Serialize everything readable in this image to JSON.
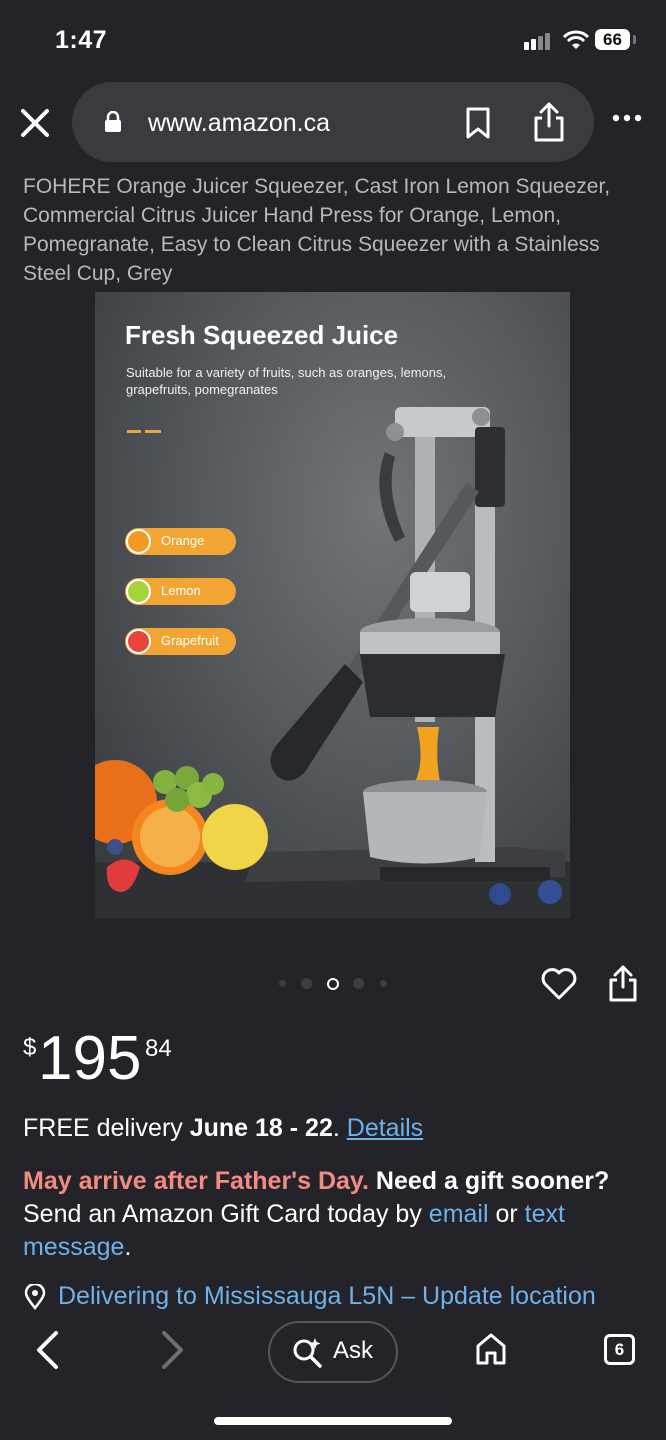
{
  "status_bar": {
    "time": "1:47",
    "battery": "66"
  },
  "browser": {
    "url": "www.amazon.ca"
  },
  "product": {
    "title": "FOHERE Orange Juicer Squeezer, Cast Iron Lemon Squeezer, Commercial Citrus Juicer Hand Press for Orange, Lemon, Pomegranate, Easy to Clean Citrus Squeezer with a Stainless Steel Cup, Grey",
    "image": {
      "heading": "Fresh Squeezed Juice",
      "subtitle": "Suitable for a variety of fruits, such as oranges, lemons, grapefruits, pomegranates",
      "fruits": [
        "Orange",
        "Lemon",
        "Grapefruit"
      ]
    },
    "carousel": {
      "total_dots": 5,
      "active_index": 2
    },
    "price": {
      "symbol": "$",
      "whole": "195",
      "fraction": "84"
    }
  },
  "delivery": {
    "prefix": "FREE delivery ",
    "dates": "June 18 - 22",
    "period": ". ",
    "details_link": "Details"
  },
  "gift": {
    "warning": "May arrive after Father's Day.",
    "question": "Need a gift sooner?",
    "text1": "Send an Amazon Gift Card today by ",
    "email_link": "email",
    "or": " or ",
    "text_link": "text message",
    "end": "."
  },
  "location": {
    "label": "Delivering to Mississauga L5N – Update location"
  },
  "bottom_nav": {
    "ask_label": "Ask",
    "tab_count": "6"
  },
  "colors": {
    "background": "#232329",
    "link": "#6fb2e8",
    "warning": "#f28c83",
    "accent": "#f2a532"
  }
}
